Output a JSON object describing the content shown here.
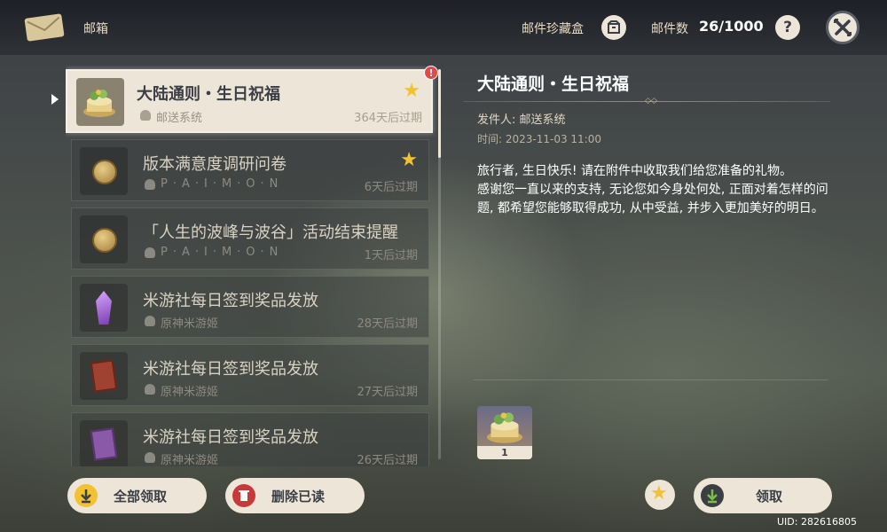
{
  "header": {
    "title": "邮箱",
    "collection_label": "邮件珍藏盒",
    "count_label": "邮件数",
    "count_value": "26/1000",
    "help_symbol": "?"
  },
  "mail_list": [
    {
      "title": "大陆通则・生日祝福",
      "sender": "邮送系统",
      "expiry": "364天后过期",
      "starred": true,
      "selected": true,
      "unread_badge": "!",
      "icon": "birthday-cake-icon"
    },
    {
      "title": "版本满意度调研问卷",
      "sender": "P·A·I·M·O·N",
      "expiry": "6天后过期",
      "starred": true,
      "selected": false,
      "icon": "mora-coin-icon"
    },
    {
      "title": "「人生的波峰与波谷」活动结束提醒",
      "sender": "P·A·I·M·O·N",
      "expiry": "1天后过期",
      "starred": false,
      "selected": false,
      "icon": "mora-coin-icon"
    },
    {
      "title": "米游社每日签到奖品发放",
      "sender": "原神米游姬",
      "expiry": "28天后过期",
      "starred": false,
      "selected": false,
      "icon": "crystal-icon"
    },
    {
      "title": "米游社每日签到奖品发放",
      "sender": "原神米游姬",
      "expiry": "27天后过期",
      "starred": false,
      "selected": false,
      "icon": "red-book-icon"
    },
    {
      "title": "米游社每日签到奖品发放",
      "sender": "原神米游姬",
      "expiry": "26天后过期",
      "starred": false,
      "selected": false,
      "icon": "purple-book-icon"
    }
  ],
  "detail": {
    "title": "大陆通则・生日祝福",
    "sender_line": "发件人: 邮送系统",
    "time_line": "时间: 2023-11-03 11:00",
    "body": "旅行者, 生日快乐! 请在附件中收取我们给您准备的礼物。\n感谢您一直以来的支持, 无论您如今身处何处, 正面对着怎样的问题, 都希望您能够取得成功, 从中受益, 并步入更加美好的明日。",
    "attachment": {
      "icon": "birthday-cake-icon",
      "count": "1"
    }
  },
  "buttons": {
    "claim_all": "全部领取",
    "delete_read": "删除已读",
    "claim": "领取"
  },
  "uid": "UID: 282616805",
  "colors": {
    "accent_gold": "#f2c230",
    "panel_light": "#ece5d8",
    "text_dark": "#3b3e44"
  }
}
